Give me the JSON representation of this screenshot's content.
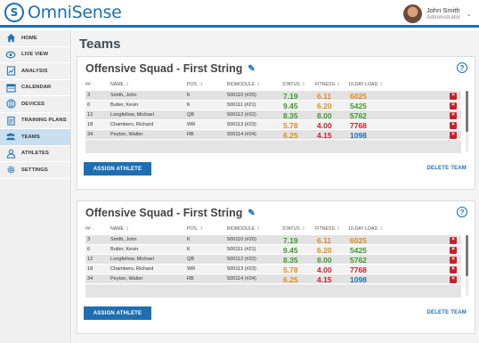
{
  "app": {
    "logo_mark": "S",
    "name": "OmniSense"
  },
  "user": {
    "name": "John Smith",
    "role": "Administrator"
  },
  "sidebar": {
    "items": [
      {
        "label": "HOME",
        "icon": "home-icon",
        "active": false
      },
      {
        "label": "LIVE VIEW",
        "icon": "eye-icon",
        "active": false
      },
      {
        "label": "ANALYSIS",
        "icon": "chart-icon",
        "active": false
      },
      {
        "label": "CALENDAR",
        "icon": "calendar-icon",
        "active": false
      },
      {
        "label": "DEVICES",
        "icon": "device-icon",
        "active": false
      },
      {
        "label": "TRAINING PLANS",
        "icon": "clipboard-icon",
        "active": false
      },
      {
        "label": "TEAMS",
        "icon": "team-icon",
        "active": true
      },
      {
        "label": "ATHLETES",
        "icon": "person-icon",
        "active": false
      },
      {
        "label": "SETTINGS",
        "icon": "gear-icon",
        "active": false
      }
    ]
  },
  "page": {
    "title": "Teams"
  },
  "colors": {
    "status": "#e08a1e",
    "fitness_high": "#3c9a2e",
    "fitness_low": "#c8202a",
    "load_orange": "#e08a1e",
    "load_green": "#3c9a2e",
    "load_red": "#c8202a",
    "load_blue": "#1d6fb1"
  },
  "table_headers": {
    "num": "##",
    "name": "NAME",
    "pos": "POS.",
    "biomodule": "BIOMODULE",
    "status": "STATUS",
    "fitness": "FITNESS",
    "load": "10-DAY LOAD"
  },
  "panels": [
    {
      "title": "Offensive Squad - First String",
      "assign_label": "ASSIGN ATHLETE",
      "delete_label": "DELETE TEAM",
      "rows": [
        {
          "num": "3",
          "name": "Smith, John",
          "pos": "K",
          "biomodule": "500110 (#20)",
          "status": "7.19",
          "fitness": "6.11",
          "load": "6025"
        },
        {
          "num": "6",
          "name": "Butler, Kevin",
          "pos": "K",
          "biomodule": "500111 (#21)",
          "status": "9.45",
          "fitness": "6.20",
          "load": "5425"
        },
        {
          "num": "12",
          "name": "Longfellow, Michael",
          "pos": "QB",
          "biomodule": "500112 (#22)",
          "status": "8.35",
          "fitness": "8.00",
          "load": "5762"
        },
        {
          "num": "18",
          "name": "Chambers, Richard",
          "pos": "WR",
          "biomodule": "500113 (#23)",
          "status": "5.78",
          "fitness": "4.00",
          "load": "7768"
        },
        {
          "num": "34",
          "name": "Peyton, Walter",
          "pos": "RB",
          "biomodule": "500114 (#24)",
          "status": "6.25",
          "fitness": "4.15",
          "load": "1098"
        }
      ]
    },
    {
      "title": "Offensive Squad - First String",
      "assign_label": "ASSIGN ATHLETE",
      "delete_label": "DELETE TEAM",
      "rows": [
        {
          "num": "3",
          "name": "Smith, John",
          "pos": "K",
          "biomodule": "500110 (#20)",
          "status": "7.19",
          "fitness": "6.11",
          "load": "6025"
        },
        {
          "num": "6",
          "name": "Butler, Kevin",
          "pos": "K",
          "biomodule": "500111 (#21)",
          "status": "9.45",
          "fitness": "6.20",
          "load": "5425"
        },
        {
          "num": "12",
          "name": "Longfellow, Michael",
          "pos": "QB",
          "biomodule": "500112 (#22)",
          "status": "8.35",
          "fitness": "8.00",
          "load": "5762"
        },
        {
          "num": "18",
          "name": "Chambers, Richard",
          "pos": "WR",
          "biomodule": "500113 (#23)",
          "status": "5.78",
          "fitness": "4.00",
          "load": "7768"
        },
        {
          "num": "34",
          "name": "Peyton, Walter",
          "pos": "RB",
          "biomodule": "500114 (#24)",
          "status": "6.25",
          "fitness": "4.15",
          "load": "1098"
        }
      ]
    }
  ]
}
